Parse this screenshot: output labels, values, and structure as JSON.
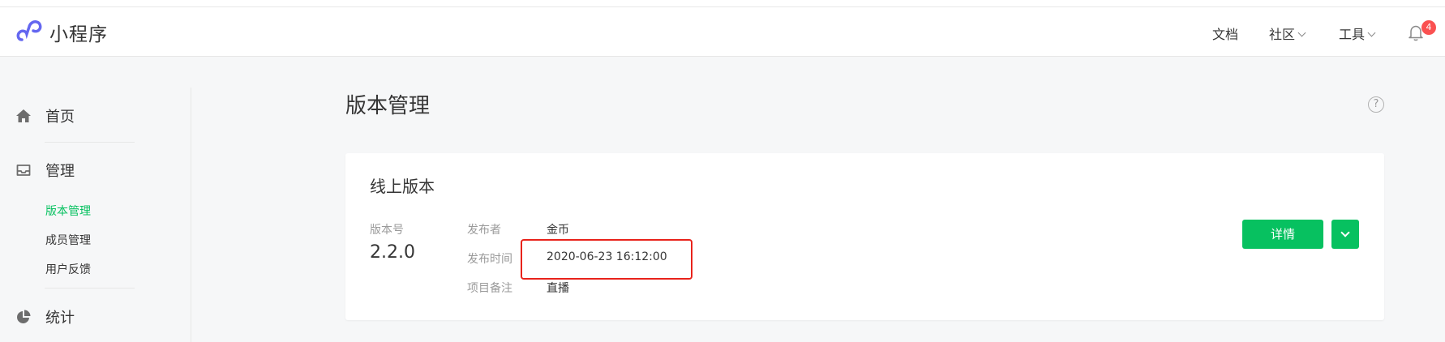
{
  "header": {
    "brand": "小程序",
    "nav": [
      {
        "label": "文档",
        "has_dropdown": false
      },
      {
        "label": "社区",
        "has_dropdown": true
      },
      {
        "label": "工具",
        "has_dropdown": true
      }
    ],
    "notification_count": "4"
  },
  "sidebar": {
    "items": [
      {
        "label": "首页",
        "icon": "home-icon"
      },
      {
        "label": "管理",
        "icon": "inbox-icon"
      },
      {
        "label": "统计",
        "icon": "pie-chart-icon"
      }
    ],
    "sub_items": [
      {
        "label": "版本管理",
        "active": true
      },
      {
        "label": "成员管理",
        "active": false
      },
      {
        "label": "用户反馈",
        "active": false
      }
    ]
  },
  "main": {
    "title": "版本管理",
    "help_icon": "?",
    "card": {
      "title": "线上版本",
      "version_label": "版本号",
      "version": "2.2.0",
      "fields": [
        {
          "label": "发布者",
          "value": "金币"
        },
        {
          "label": "发布时间",
          "value": "2020-06-23 16:12:00"
        },
        {
          "label": "项目备注",
          "value": "直播"
        }
      ],
      "detail_button": "详情"
    }
  },
  "colors": {
    "accent": "#07c160",
    "highlight": "#e8231b",
    "logo": "#6467f0",
    "badge": "#fa5151"
  }
}
